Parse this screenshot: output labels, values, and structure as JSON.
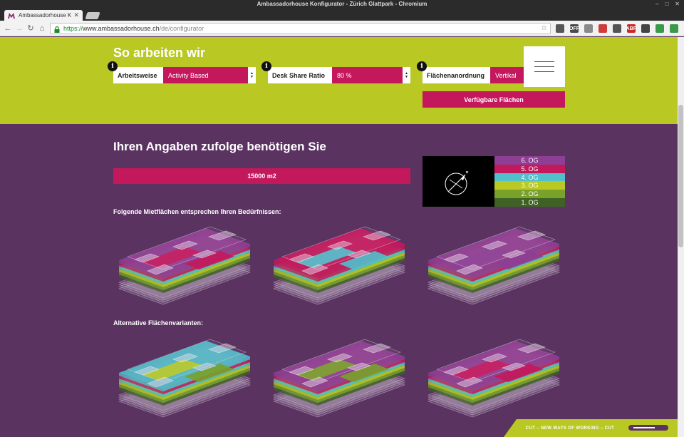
{
  "browser": {
    "window_title": "Ambassadorhouse Konfigurator - Zürich Glattpark - Chromium",
    "tab_title": "Ambassadorhouse Ko",
    "url_scheme": "https://",
    "url_host": "www.ambassadorhouse.ch",
    "url_path": "/de/configurator",
    "extensions": [
      {
        "name": "screenshot-icon",
        "label": "",
        "color": "#555555"
      },
      {
        "name": "ext-off-icon",
        "label": "OFF",
        "color": "#4a4a4a"
      },
      {
        "name": "cloud-icon",
        "label": "",
        "color": "#8a8a8a"
      },
      {
        "name": "bookmark-ext-icon",
        "label": "",
        "color": "#d23b3b"
      },
      {
        "name": "gear-ext-icon",
        "label": "",
        "color": "#555555"
      },
      {
        "name": "abp-icon",
        "label": "ABP",
        "color": "#c82828"
      },
      {
        "name": "eye-icon",
        "label": "",
        "color": "#444444"
      },
      {
        "name": "translate-icon",
        "label": "",
        "color": "#3a9a4a"
      },
      {
        "name": "refresh-ext-icon",
        "label": "",
        "color": "#3a9a4a"
      },
      {
        "name": "more-icon",
        "label": "⋮",
        "color": "#f2f2f2"
      }
    ]
  },
  "header": {
    "title": "So arbeiten wir",
    "controls": [
      {
        "label": "Arbeitsweise",
        "value": "Activity Based"
      },
      {
        "label": "Desk Share Ratio",
        "value": "80 %"
      },
      {
        "label": "Flächenanordnung",
        "value": "Vertikal"
      }
    ],
    "info_label": "i",
    "cta_label": "Verfügbare Flächen"
  },
  "result": {
    "title": "Ihren Angaben zufolge benötigen Sie",
    "area": "15000 m2",
    "matching_heading": "Folgende Mietflächen entsprechen Ihren Bedürfnissen:",
    "alternative_heading": "Alternative Flächenvarianten:"
  },
  "legend": {
    "floors": [
      {
        "label": "6. OG",
        "color": "#8e3f94"
      },
      {
        "label": "5. OG",
        "color": "#c4185c"
      },
      {
        "label": "4. OG",
        "color": "#4fc0cc"
      },
      {
        "label": "3. OG",
        "color": "#b9c823"
      },
      {
        "label": "2. OG",
        "color": "#7aa12a"
      },
      {
        "label": "1. OG",
        "color": "#3e6224"
      }
    ]
  },
  "models": {
    "matching": [
      {
        "top": "#8e3f94",
        "highlight": [
          "#c4185c",
          "#c4185c"
        ]
      },
      {
        "top": "#c4185c",
        "highlight": [
          "#4fc0cc",
          "#4fc0cc"
        ]
      },
      {
        "top": "#8e3f94",
        "highlight": [
          "#8e3f94",
          "#8e3f94"
        ]
      }
    ],
    "alternative": [
      {
        "top": "#4fc0cc",
        "highlight": [
          "#b9c823",
          "#7aa12a"
        ]
      },
      {
        "top": "#8e3f94",
        "highlight": [
          "#7aa12a",
          "#7aa12a"
        ]
      },
      {
        "top": "#8e3f94",
        "highlight": [
          "#c4185c",
          "#c4185c"
        ]
      }
    ]
  },
  "footer": {
    "text": "CUT – NEW WAYS OF WORKING – CUT"
  }
}
